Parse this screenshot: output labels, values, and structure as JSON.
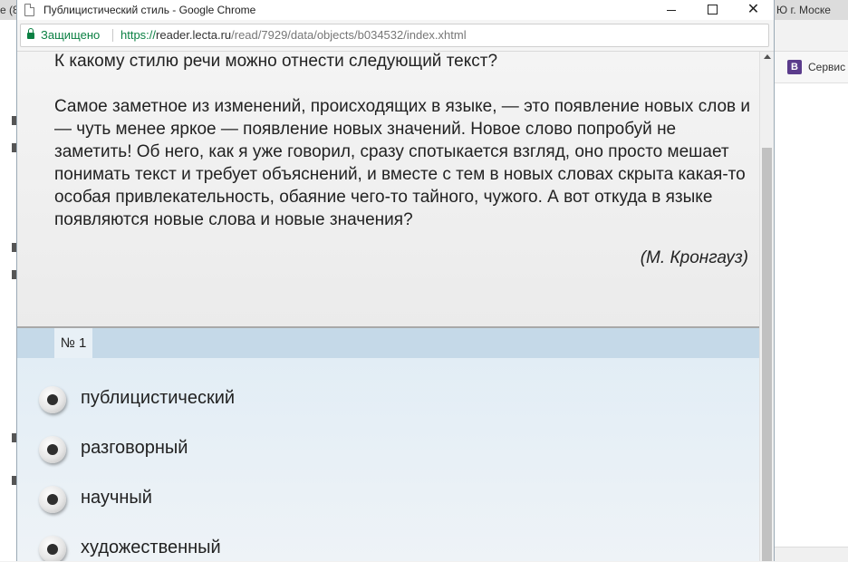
{
  "background_window": {
    "left_tab_text": "e (8",
    "right_tab_text": "Ю г. Моске",
    "bookmark_label": "Сервис",
    "bookmark_icon_letter": "B"
  },
  "window": {
    "title": "Публицистический стиль - Google Chrome",
    "close_glyph": "✕"
  },
  "addressbar": {
    "secure_label": "Защищено",
    "url_scheme": "https://",
    "url_host": "reader.lecta.ru",
    "url_path": "/read/7929/data/objects/b034532/index.xhtml"
  },
  "question": {
    "prompt": "К какому стилю речи можно отнести следующий текст?",
    "passage": "Самое заметное из изменений, происходящих в языке, — это появление новых слов и — чуть менее яркое — появление новых значений. Новое слово попробуй не заметить! Об него, как я уже говорил, сразу спотыкается взгляд, оно просто мешает понимать текст и требует объяснений, и вместе с тем в новых словах скрыта какая-то особая привлекательность, обаяние чего-то тайного, чужого. А вот откуда в языке появляются новые слова и новые значения?",
    "author": "(М. Кронгауз)"
  },
  "task": {
    "number_label": "№ 1"
  },
  "answers": [
    {
      "label": "публицистический"
    },
    {
      "label": "разговорный"
    },
    {
      "label": "научный"
    },
    {
      "label": "художественный"
    }
  ]
}
